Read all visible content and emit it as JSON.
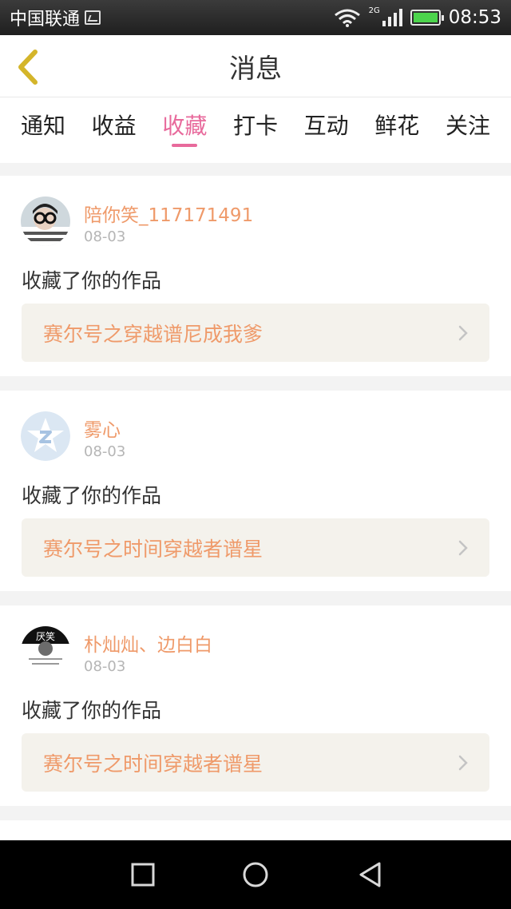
{
  "status_bar": {
    "carrier": "中国联通",
    "network_type": "2G",
    "time": "08:53",
    "battery_color": "#4cd44c"
  },
  "header": {
    "title": "消息",
    "back_icon": "chevron-left-icon",
    "back_color": "#d4b52a"
  },
  "tabs": [
    {
      "label": "通知",
      "active": false
    },
    {
      "label": "收益",
      "active": false
    },
    {
      "label": "收藏",
      "active": true
    },
    {
      "label": "打卡",
      "active": false
    },
    {
      "label": "互动",
      "active": false
    },
    {
      "label": "鲜花",
      "active": false
    },
    {
      "label": "关注",
      "active": false
    }
  ],
  "colors": {
    "accent": "#e86a9c",
    "username": "#ef9a6a",
    "work_bg": "#f4f2ec"
  },
  "feed": [
    {
      "username": "陪你笑_117171491",
      "date": "08-03",
      "action": "收藏了你的作品",
      "work_title": "赛尔号之穿越谱尼成我爹",
      "avatar": "photo-avatar"
    },
    {
      "username": "雾心",
      "date": "08-03",
      "action": "收藏了你的作品",
      "work_title": "赛尔号之时间穿越者谱星",
      "avatar": "default-star-avatar"
    },
    {
      "username": "朴灿灿、边白白",
      "date": "08-03",
      "action": "收藏了你的作品",
      "work_title": "赛尔号之时间穿越者谱星",
      "avatar": "text-badge-avatar",
      "avatar_text": "厌笑"
    }
  ],
  "nav_bar": {
    "buttons": [
      "square-icon",
      "circle-icon",
      "triangle-back-icon"
    ]
  }
}
